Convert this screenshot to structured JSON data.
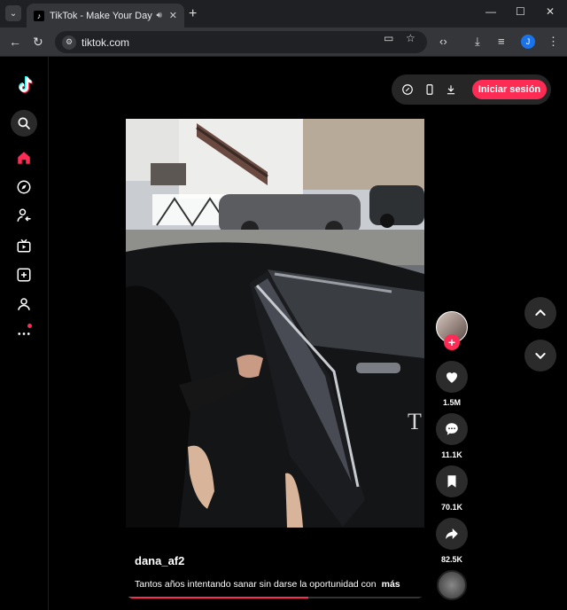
{
  "browser": {
    "tab_title": "TikTok - Make Your Day",
    "url": "tiktok.com",
    "profile_initial": "J"
  },
  "topbar": {
    "login_label": "Iniciar sesión"
  },
  "video": {
    "username": "dana_af2",
    "caption": "Tantos años intentando sanar sin darse la oportunidad con",
    "more_label": "más",
    "progress": 0.61
  },
  "actions": {
    "likes": "1.5M",
    "comments": "11.1K",
    "saves": "70.1K",
    "shares": "82.5K"
  },
  "colors": {
    "accent": "#fe2c55",
    "button_bg": "#2b2b2b"
  }
}
